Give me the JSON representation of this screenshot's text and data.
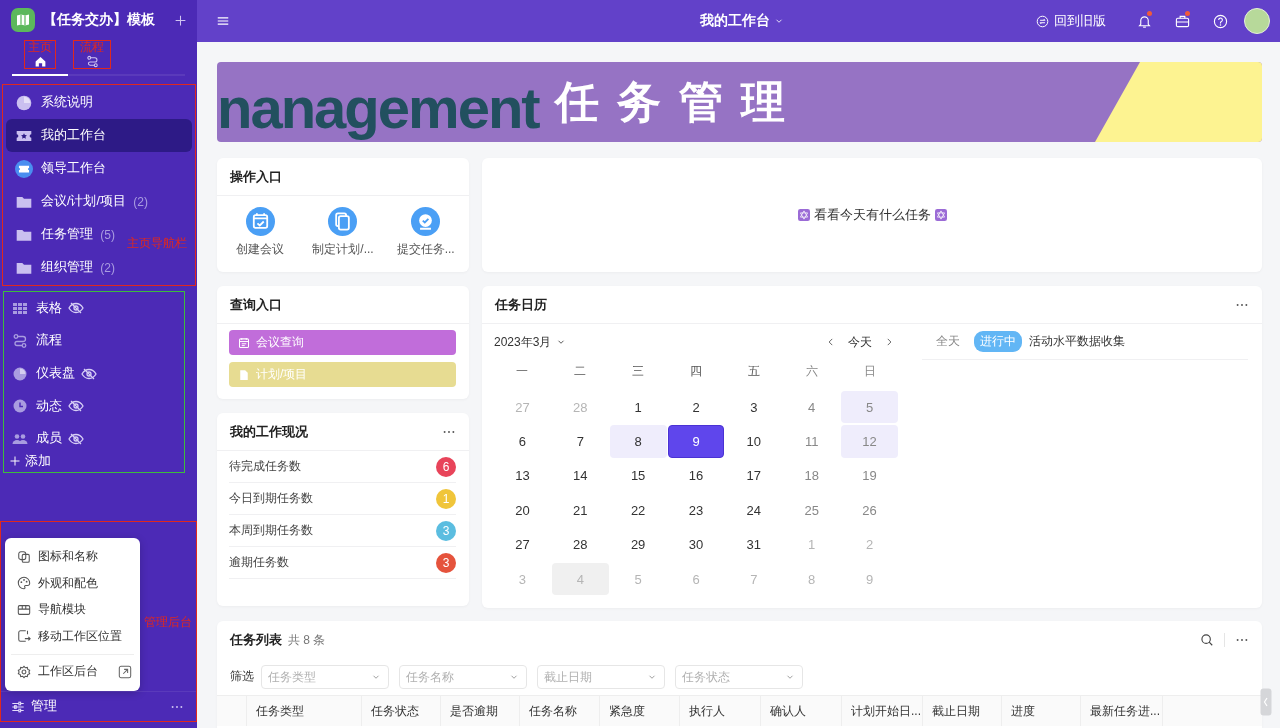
{
  "sidebar": {
    "title": "【任务交办】模板",
    "tabs": [
      {
        "kind": "home",
        "selected": true,
        "annotation": {
          "label": "主页",
          "color": "#e0281e"
        }
      },
      {
        "kind": "flow",
        "selected": false,
        "annotation": {
          "label": "流程",
          "color": "#e0281e"
        }
      }
    ],
    "nav": {
      "annotation": {
        "label": "主页导航栏",
        "color": "#e0281e"
      },
      "items": [
        {
          "label": "系统说明",
          "selected": false
        },
        {
          "label": "我的工作台",
          "selected": true
        },
        {
          "label": "领导工作台",
          "selected": false
        },
        {
          "label": "会议/计划/项目",
          "count": "(2)",
          "selected": false
        },
        {
          "label": "任务管理",
          "count": "(5)",
          "selected": false
        },
        {
          "label": "组织管理",
          "count": "(2)",
          "selected": false
        }
      ]
    },
    "objects": {
      "annotation": {
        "color": "#3dbb3d"
      },
      "items": [
        {
          "label": "表格",
          "hidden": true
        },
        {
          "label": "流程",
          "hidden": false
        },
        {
          "label": "仪表盘",
          "hidden": true
        },
        {
          "label": "动态",
          "hidden": true
        },
        {
          "label": "成员",
          "hidden": true
        }
      ],
      "add_label": "添加"
    },
    "manage": {
      "annotation": {
        "label": "管理后台",
        "color": "#e0281e"
      },
      "menu": [
        {
          "label": "图标和名称",
          "external": false
        },
        {
          "label": "外观和配色",
          "external": false
        },
        {
          "label": "导航模块",
          "external": false
        },
        {
          "label": "移动工作区位置",
          "external": false
        },
        {
          "label": "工作区后台",
          "external": true
        }
      ],
      "label": "管理"
    }
  },
  "topbar": {
    "title": "我的工作台",
    "old_version": "回到旧版",
    "buttons": [
      {
        "kind": "bell",
        "dot": true
      },
      {
        "kind": "briefcase",
        "dot": true
      },
      {
        "kind": "help",
        "dot": false
      }
    ]
  },
  "banner": {
    "bg_text": "nanagement",
    "title": "任务管理"
  },
  "quick_actions": {
    "title": "操作入口",
    "actions": [
      {
        "label": "创建会议"
      },
      {
        "label": "制定计划/..."
      },
      {
        "label": "提交任务..."
      }
    ]
  },
  "today_card": {
    "text": "看看今天有什么任务"
  },
  "query": {
    "title": "查询入口",
    "buttons": [
      {
        "label": "会议查询",
        "color": "#c16dda"
      },
      {
        "label": "计划/项目",
        "color": "#e7dc92"
      }
    ]
  },
  "work_status": {
    "title": "我的工作现况",
    "rows": [
      {
        "label": "待完成任务数",
        "count": "6",
        "color": "#e8445a"
      },
      {
        "label": "今日到期任务数",
        "count": "1",
        "color": "#f0c53a"
      },
      {
        "label": "本周到期任务数",
        "count": "3",
        "color": "#5bbde0"
      },
      {
        "label": "逾期任务数",
        "count": "3",
        "color": "#e5533c"
      }
    ]
  },
  "calendar": {
    "title": "任务日历",
    "month": "2023年3月",
    "today_label": "今天",
    "weekdays": [
      "一",
      "二",
      "三",
      "四",
      "五",
      "六",
      "日"
    ],
    "weeks": [
      [
        {
          "day": "27",
          "outside": true,
          "marked": false,
          "selected": false,
          "hovered": false
        },
        {
          "day": "28",
          "outside": true,
          "marked": false,
          "selected": false,
          "hovered": false
        },
        {
          "day": "1",
          "outside": false,
          "marked": false,
          "selected": false,
          "hovered": false
        },
        {
          "day": "2",
          "outside": false,
          "marked": false,
          "selected": false,
          "hovered": false
        },
        {
          "day": "3",
          "outside": false,
          "marked": false,
          "selected": false,
          "hovered": false
        },
        {
          "day": "4",
          "outside": false,
          "marked": false,
          "selected": false,
          "hovered": false
        },
        {
          "day": "5",
          "outside": false,
          "marked": true,
          "selected": false,
          "hovered": false
        }
      ],
      [
        {
          "day": "6",
          "outside": false,
          "marked": false,
          "selected": false,
          "hovered": false
        },
        {
          "day": "7",
          "outside": false,
          "marked": false,
          "selected": false,
          "hovered": false
        },
        {
          "day": "8",
          "outside": false,
          "marked": true,
          "selected": false,
          "hovered": false
        },
        {
          "day": "9",
          "outside": false,
          "marked": false,
          "selected": true,
          "hovered": false
        },
        {
          "day": "10",
          "outside": false,
          "marked": false,
          "selected": false,
          "hovered": false
        },
        {
          "day": "11",
          "outside": false,
          "marked": false,
          "selected": false,
          "hovered": false
        },
        {
          "day": "12",
          "outside": false,
          "marked": true,
          "selected": false,
          "hovered": false
        }
      ],
      [
        {
          "day": "13",
          "outside": false,
          "marked": false,
          "selected": false,
          "hovered": false
        },
        {
          "day": "14",
          "outside": false,
          "marked": false,
          "selected": false,
          "hovered": false
        },
        {
          "day": "15",
          "outside": false,
          "marked": false,
          "selected": false,
          "hovered": false
        },
        {
          "day": "16",
          "outside": false,
          "marked": false,
          "selected": false,
          "hovered": false
        },
        {
          "day": "17",
          "outside": false,
          "marked": false,
          "selected": false,
          "hovered": false
        },
        {
          "day": "18",
          "outside": false,
          "marked": false,
          "selected": false,
          "hovered": false
        },
        {
          "day": "19",
          "outside": false,
          "marked": false,
          "selected": false,
          "hovered": false
        }
      ],
      [
        {
          "day": "20",
          "outside": false,
          "marked": false,
          "selected": false,
          "hovered": false
        },
        {
          "day": "21",
          "outside": false,
          "marked": false,
          "selected": false,
          "hovered": false
        },
        {
          "day": "22",
          "outside": false,
          "marked": false,
          "selected": false,
          "hovered": false
        },
        {
          "day": "23",
          "outside": false,
          "marked": false,
          "selected": false,
          "hovered": false
        },
        {
          "day": "24",
          "outside": false,
          "marked": false,
          "selected": false,
          "hovered": false
        },
        {
          "day": "25",
          "outside": false,
          "marked": false,
          "selected": false,
          "hovered": false
        },
        {
          "day": "26",
          "outside": false,
          "marked": false,
          "selected": false,
          "hovered": false
        }
      ],
      [
        {
          "day": "27",
          "outside": false,
          "marked": false,
          "selected": false,
          "hovered": false
        },
        {
          "day": "28",
          "outside": false,
          "marked": false,
          "selected": false,
          "hovered": false
        },
        {
          "day": "29",
          "outside": false,
          "marked": false,
          "selected": false,
          "hovered": false
        },
        {
          "day": "30",
          "outside": false,
          "marked": false,
          "selected": false,
          "hovered": false
        },
        {
          "day": "31",
          "outside": false,
          "marked": false,
          "selected": false,
          "hovered": false
        },
        {
          "day": "1",
          "outside": true,
          "marked": false,
          "selected": false,
          "hovered": false
        },
        {
          "day": "2",
          "outside": true,
          "marked": false,
          "selected": false,
          "hovered": false
        }
      ],
      [
        {
          "day": "3",
          "outside": true,
          "marked": false,
          "selected": false,
          "hovered": false
        },
        {
          "day": "4",
          "outside": true,
          "marked": false,
          "selected": false,
          "hovered": true
        },
        {
          "day": "5",
          "outside": true,
          "marked": false,
          "selected": false,
          "hovered": false
        },
        {
          "day": "6",
          "outside": true,
          "marked": false,
          "selected": false,
          "hovered": false
        },
        {
          "day": "7",
          "outside": true,
          "marked": false,
          "selected": false,
          "hovered": false
        },
        {
          "day": "8",
          "outside": true,
          "marked": false,
          "selected": false,
          "hovered": false
        },
        {
          "day": "9",
          "outside": true,
          "marked": false,
          "selected": false,
          "hovered": false
        }
      ]
    ],
    "allday_label": "全天",
    "events": [
      {
        "status": "进行中",
        "title": "活动水平数据收集",
        "color": "#62b6f5"
      }
    ]
  },
  "task_list": {
    "title": "任务列表",
    "count": "共 8 条",
    "filter_label": "筛选",
    "filters": [
      {
        "placeholder": "任务类型"
      },
      {
        "placeholder": "任务名称"
      },
      {
        "placeholder": "截止日期"
      },
      {
        "placeholder": "任务状态"
      }
    ],
    "columns": [
      "任务类型",
      "任务状态",
      "是否逾期",
      "任务名称",
      "紧急度",
      "执行人",
      "确认人",
      "计划开始日...",
      "截止日期",
      "进度",
      "最新任务进..."
    ]
  }
}
